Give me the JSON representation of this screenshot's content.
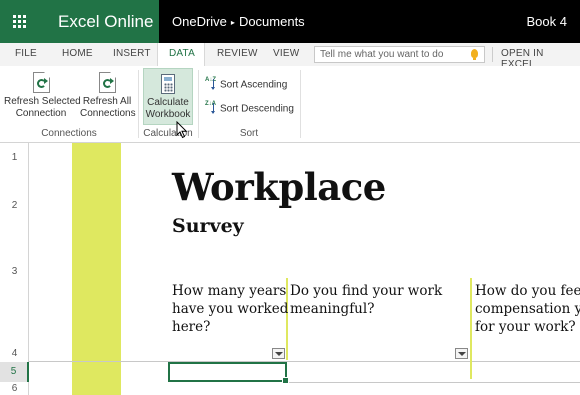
{
  "app": {
    "brand": "Excel Online",
    "breadcrumb": {
      "location": "OneDrive",
      "separator": "▸",
      "folder": "Documents"
    },
    "document_title": "Book 4"
  },
  "tabs": [
    {
      "label": "FILE"
    },
    {
      "label": "HOME"
    },
    {
      "label": "INSERT"
    },
    {
      "label": "DATA",
      "active": true
    },
    {
      "label": "REVIEW"
    },
    {
      "label": "VIEW"
    }
  ],
  "tell_me": {
    "placeholder": "Tell me what you want to do"
  },
  "open_in_excel": "OPEN IN EXCEL",
  "ribbon": {
    "connections": {
      "refresh_selected": {
        "line1": "Refresh Selected",
        "line2": "Connection"
      },
      "refresh_all": {
        "line1": "Refresh All",
        "line2": "Connections"
      },
      "group_label": "Connections"
    },
    "calculation": {
      "calculate": {
        "line1": "Calculate",
        "line2": "Workbook"
      },
      "group_label": "Calculation"
    },
    "sort": {
      "ascending": "Sort Ascending",
      "descending": "Sort Descending",
      "asc_glyph": "A↓Z",
      "desc_glyph": "Z↓A",
      "group_label": "Sort"
    }
  },
  "sheet": {
    "row_numbers": [
      "1",
      "2",
      "3",
      "4",
      "5",
      "6"
    ],
    "selected_row": "5",
    "title": "Workplace",
    "subtitle": "Survey",
    "questions": [
      "How many years\nhave you worked\nhere?",
      "Do you find your work\nmeaningful?",
      "How do you feel\ncompensation y\nfor your work?"
    ]
  },
  "colors": {
    "brand_green": "#217346",
    "title_bar": "#000000",
    "accent_column": "#dfe860"
  }
}
